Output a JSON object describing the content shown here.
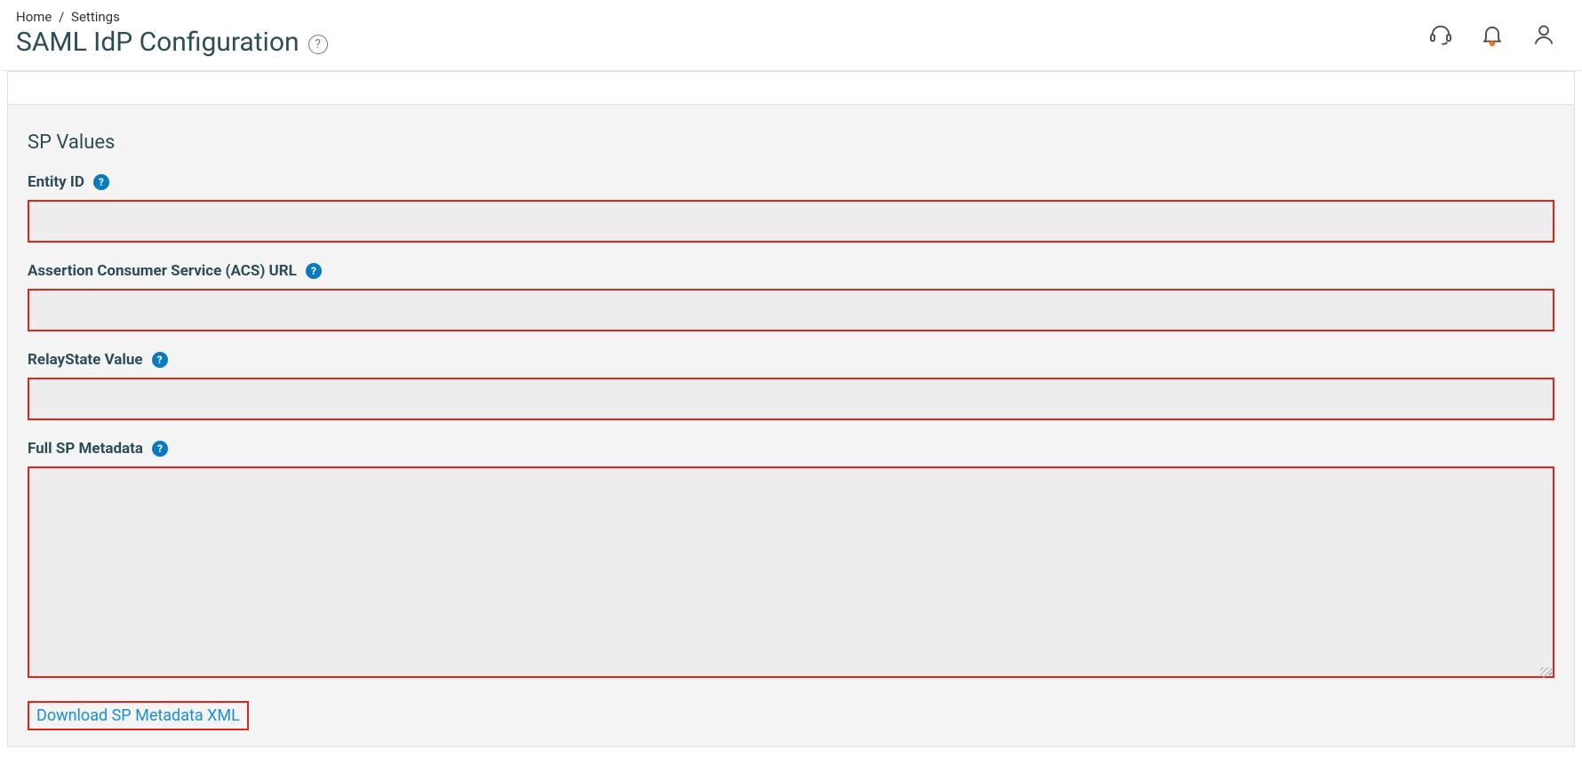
{
  "breadcrumb": {
    "home": "Home",
    "settings": "Settings"
  },
  "page": {
    "title": "SAML IdP Configuration"
  },
  "section": {
    "title": "SP Values"
  },
  "fields": {
    "entity_id": {
      "label": "Entity ID",
      "value": ""
    },
    "acs_url": {
      "label": "Assertion Consumer Service (ACS) URL",
      "value": ""
    },
    "relay_state": {
      "label": "RelayState Value",
      "value": ""
    },
    "full_metadata": {
      "label": "Full SP Metadata",
      "value": ""
    }
  },
  "actions": {
    "download_metadata": "Download SP Metadata XML"
  },
  "glyphs": {
    "question": "?"
  }
}
